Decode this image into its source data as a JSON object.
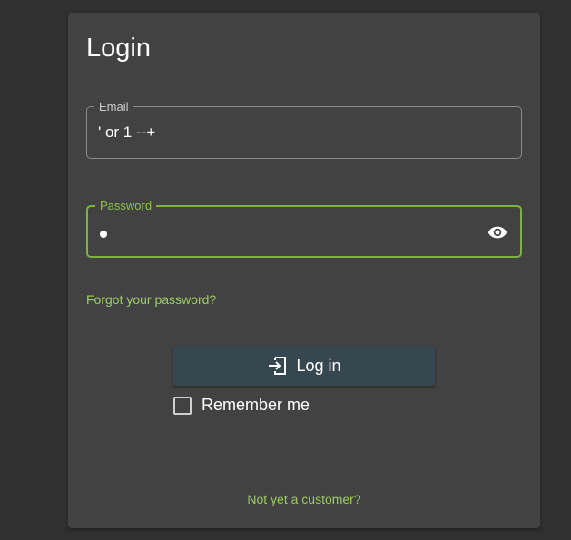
{
  "login": {
    "title": "Login",
    "email": {
      "label": "Email",
      "value": "' or 1 --+"
    },
    "password": {
      "label": "Password",
      "value_masked": "•",
      "toggle_icon": "eye-icon"
    },
    "forgot_link": "Forgot your password?",
    "login_button": {
      "label": "Log in",
      "icon": "login-icon"
    },
    "remember_me": {
      "label": "Remember me",
      "checked": false
    },
    "signup_link": "Not yet a customer?"
  },
  "colors": {
    "background": "#303030",
    "card": "#424242",
    "accent": "#8bc34a",
    "button": "#37474f"
  }
}
